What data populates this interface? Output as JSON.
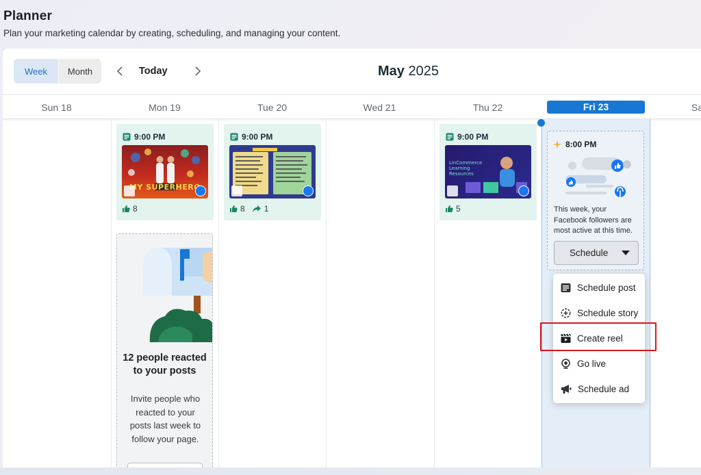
{
  "page": {
    "title": "Planner",
    "subtitle": "Plan your marketing calendar by creating, scheduling, and managing your content."
  },
  "toolbar": {
    "view_week": "Week",
    "view_month": "Month",
    "today": "Today",
    "month": "May",
    "year": "2025"
  },
  "days": [
    {
      "label": "Sun 18"
    },
    {
      "label": "Mon 19"
    },
    {
      "label": "Tue 20"
    },
    {
      "label": "Wed 21"
    },
    {
      "label": "Thu 22"
    },
    {
      "label": "Fri 23",
      "active": true
    },
    {
      "label": "Sa"
    }
  ],
  "posts": [
    {
      "day": "Mon 19",
      "time": "9:00 PM",
      "likes": "8",
      "thumb_text": "MY SUPERHERO"
    },
    {
      "day": "Tue 20",
      "time": "9:00 PM",
      "likes": "8",
      "shares": "1"
    },
    {
      "day": "Thu 22",
      "time": "9:00 PM",
      "likes": "5",
      "thumb_text": "LinCommerce Learning Resources"
    }
  ],
  "invite": {
    "title": "12 people reacted to your posts",
    "body": "Invite people who reacted to your posts last week to follow your page."
  },
  "best_time": {
    "time": "8:00 PM",
    "text": "This week, your Facebook followers are most active at this time.",
    "button": "Schedule"
  },
  "schedule_menu": {
    "items": [
      {
        "label": "Schedule post",
        "icon": "post-icon"
      },
      {
        "label": "Schedule story",
        "icon": "story-icon"
      },
      {
        "label": "Create reel",
        "icon": "reel-icon",
        "highlighted": true
      },
      {
        "label": "Go live",
        "icon": "live-icon"
      },
      {
        "label": "Schedule ad",
        "icon": "megaphone-icon"
      }
    ]
  },
  "colors": {
    "accent": "#1877d2",
    "post_card": "#e3f3ee",
    "highlight": "#d9161b"
  }
}
